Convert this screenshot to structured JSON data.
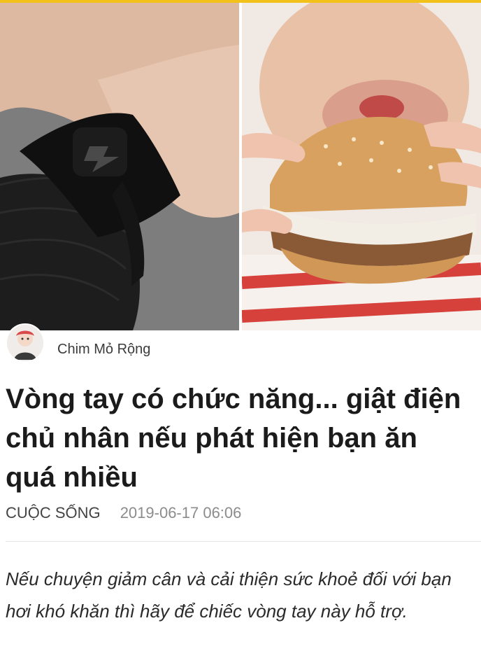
{
  "colors": {
    "accent": "#f2c21b",
    "title": "#1b1b1b",
    "meta": "#8c8c8c"
  },
  "images": {
    "left": {
      "icon": "bracelet-photo",
      "description_hidden": true
    },
    "right": {
      "icon": "burger-photo",
      "description_hidden": true
    }
  },
  "author": {
    "name": "Chim Mỏ Rộng",
    "icon": "avatar"
  },
  "article": {
    "title": "Vòng tay có chức năng... giật điện chủ nhân nếu phát hiện bạn ăn quá nhiều",
    "category": "CUỘC SỐNG",
    "date": "2019-06-17 06:06",
    "lead": "Nếu chuyện giảm cân và cải thiện sức khoẻ đối với bạn hơi khó khăn thì hãy để chiếc vòng tay này hỗ trợ."
  }
}
